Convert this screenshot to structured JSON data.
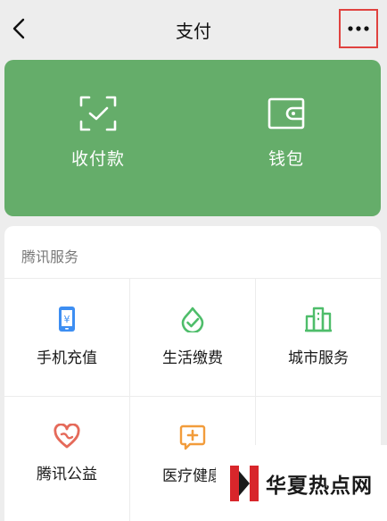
{
  "header": {
    "title": "支付"
  },
  "pay_panel": {
    "items": [
      {
        "label": "收付款",
        "icon": "scan-check-icon"
      },
      {
        "label": "钱包",
        "icon": "wallet-icon"
      }
    ]
  },
  "services": {
    "section_title": "腾讯服务",
    "items": [
      {
        "label": "手机充值",
        "icon": "phone-recharge-icon"
      },
      {
        "label": "生活缴费",
        "icon": "utility-payment-icon"
      },
      {
        "label": "城市服务",
        "icon": "city-buildings-icon"
      },
      {
        "label": "腾讯公益",
        "icon": "charity-heart-icon"
      },
      {
        "label": "医疗健康",
        "icon": "medical-cross-icon"
      }
    ]
  },
  "watermark": {
    "text": "华夏热点网"
  },
  "colors": {
    "green_panel": "#65ad6a",
    "highlight_border": "#e0423f",
    "blue_icon": "#3d8ef2",
    "green_icon": "#4ebd6a",
    "red_icon": "#e56a5a",
    "orange_icon": "#f29c3b"
  }
}
